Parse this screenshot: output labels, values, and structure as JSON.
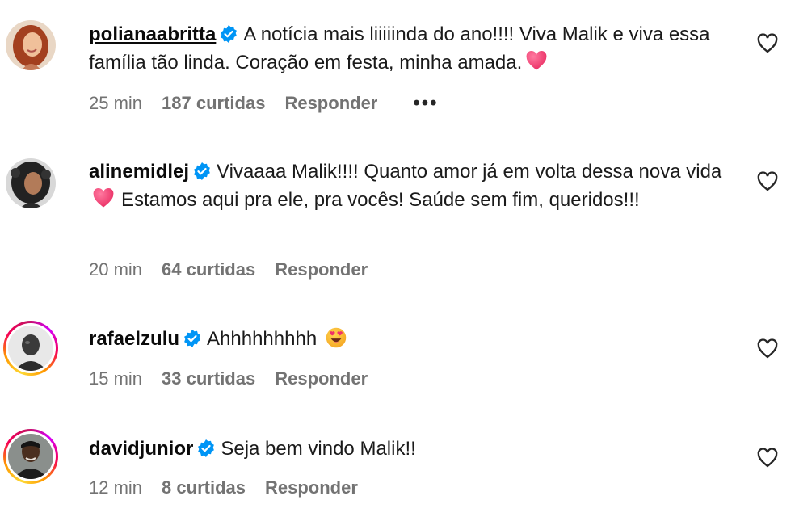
{
  "colors": {
    "verified_blue": "#0095f6",
    "meta_gray": "#737373",
    "heart_emoji": "#f0306a"
  },
  "comments": [
    {
      "username": "polianaabritta",
      "verified": true,
      "text": "A notícia mais liiiiinda do ano!!!! Viva Malik e viva essa família tão linda. Coração em festa, minha amada.",
      "emoji": "heart-emoji",
      "time": "25 min",
      "likes": "187 curtidas",
      "reply": "Responder",
      "more": "•••",
      "avatar_icon": "woman-red-hair-avatar"
    },
    {
      "username": "alinemidlej",
      "verified": true,
      "text_part1": "Vivaaaa Malik!!!! Quanto amor já em volta dessa nova vida",
      "text_part2": "Estamos aqui pra ele, pra vocês! Saúde sem fim, queridos!!!",
      "emoji": "heart-emoji",
      "time": "20 min",
      "likes": "64 curtidas",
      "reply": "Responder",
      "avatar_icon": "woman-curly-hair-avatar"
    },
    {
      "username": "rafaelzulu",
      "verified": true,
      "text": "Ahhhhhhhhh",
      "emoji": "heart-eyes-emoji",
      "time": "15 min",
      "likes": "33 curtidas",
      "reply": "Responder",
      "avatar_icon": "man-bald-avatar"
    },
    {
      "username": "davidjunior",
      "verified": true,
      "text": "Seja bem vindo Malik!!",
      "time": "12 min",
      "likes": "8 curtidas",
      "reply": "Responder",
      "avatar_icon": "man-dark-avatar"
    }
  ]
}
